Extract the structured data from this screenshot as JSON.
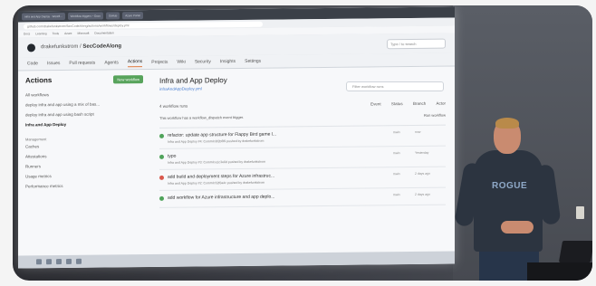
{
  "browser": {
    "tabs": [
      "Infra and App Deploy · Workfl...",
      "Workflow triggers – Docs",
      "GitHub",
      "Azure Portal"
    ],
    "url": "github.com/drakefunkstrom/SecCodeAlong/actions/workflows/deploy.yml",
    "bookmarks": [
      "Docs",
      "Learning",
      "Tools",
      "Azure",
      "Microsoft",
      "Documentation"
    ]
  },
  "gh": {
    "owner": "drakefunkstrom",
    "separator": "/",
    "repo": "SecCodeAlong",
    "search_placeholder": "Type / to search",
    "nav": [
      "Code",
      "Issues",
      "Pull requests",
      "Agents",
      "Actions",
      "Projects",
      "Wiki",
      "Security",
      "Insights",
      "Settings"
    ]
  },
  "sidebar": {
    "title": "Actions",
    "new_workflow": "New workflow",
    "items": [
      "All workflows",
      "deploy infra and app using a mix of bas...",
      "deploy infra and app using bash script",
      "Infra and App Deploy"
    ],
    "management_label": "Management",
    "management": [
      "Caches",
      "Attestations",
      "Runners",
      "Usage metrics",
      "Performance metrics"
    ]
  },
  "main": {
    "workflow_title": "Infra and App Deploy",
    "workflow_file": "infraAndAppDeploy.yml",
    "filter_placeholder": "Filter workflow runs",
    "runs_count": "4 workflow runs",
    "filters": [
      "Event",
      "Status",
      "Branch",
      "Actor"
    ],
    "dispatch_text": "This workflow has a workflow_dispatch event trigger.",
    "run_workflow": "Run workflow",
    "runs": [
      {
        "title": "refactor: update app structure for Flappy Bird game l...",
        "meta": "Infra and App Deploy #4: Commit 8f2b6f9 pushed by drakefunkstrom",
        "branch": "main",
        "time": "now",
        "status": "ok"
      },
      {
        "title": "typo",
        "meta": "Infra and App Deploy #3: Commit a1c3e0d pushed by drakefunkstrom",
        "branch": "main",
        "time": "Yesterday",
        "status": "ok"
      },
      {
        "title": "add build and deployment steps for Azure infrastruc...",
        "meta": "Infra and App Deploy #2: Commit 62f0a4c pushed by drakefunkstrom",
        "branch": "main",
        "time": "2 days ago",
        "status": "fail"
      },
      {
        "title": "add workflow for Azure infrastructure and app deplo...",
        "meta": "",
        "branch": "main",
        "time": "2 days ago",
        "status": "ok"
      }
    ]
  },
  "presenter": {
    "shirt_text": "ROGUE"
  },
  "colors": {
    "success": "#4fa35a",
    "failure": "#d9584c",
    "accent": "#e07a3f",
    "link": "#4a7fd1"
  }
}
